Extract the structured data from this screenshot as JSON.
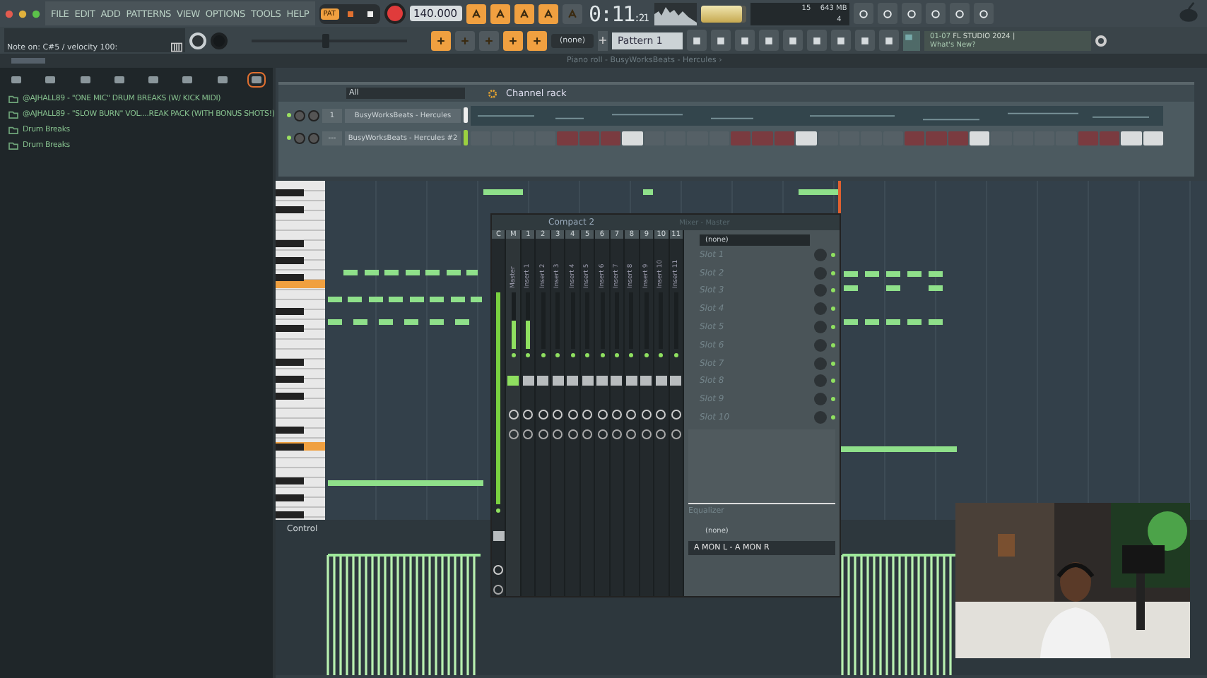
{
  "menu": [
    "FILE",
    "EDIT",
    "ADD",
    "PATTERNS",
    "VIEW",
    "OPTIONS",
    "TOOLS",
    "HELP"
  ],
  "transport": {
    "mode": "PAT",
    "tempo": "140.000",
    "time": "0:11",
    "time_sub": ":21"
  },
  "master_volume": {
    "level": 0.9
  },
  "song_position": {
    "level": 0.45
  },
  "hint": "Note on: C#5 / velocity 100:",
  "monitor": {
    "cpu": "15",
    "ram": "643 MB",
    "voices": "4"
  },
  "pattern": "Pattern 1",
  "plugin_picker": "(none)",
  "news": {
    "date": "01-07",
    "title": "FL STUDIO 2024 |",
    "link": "What's New?"
  },
  "piano_roll_title": "Piano roll - BusyWorksBeats - Hercules ›",
  "browser": {
    "items": [
      {
        "label": "@AJHALL89 - \"ONE MIC\" DRUM BREAKS (W/ KICK MIDI)"
      },
      {
        "label": "@AJHALL89 - \"SLOW BURN\" VOL....REAK PACK (WITH BONUS SHOTS!)"
      },
      {
        "label": "Drum Breaks"
      },
      {
        "label": "Drum Breaks"
      }
    ]
  },
  "channel_rack": {
    "title": "Channel rack",
    "filter": "All",
    "channels": [
      {
        "kind": "roll",
        "number": "1",
        "name": "BusyWorksBeats - Hercules"
      },
      {
        "kind": "steps",
        "number": "---",
        "name": "BusyWorksBeats - Hercules #2",
        "steps": [
          false,
          false,
          false,
          false,
          false,
          false,
          false,
          true,
          false,
          false,
          false,
          false,
          false,
          false,
          false,
          true,
          false,
          false,
          false,
          false,
          false,
          false,
          false,
          true,
          false,
          false,
          false,
          false,
          false,
          false,
          true,
          true
        ]
      }
    ]
  },
  "mixer": {
    "title": "Compact 2",
    "subtitle": "Mixer - Master",
    "tracks": [
      {
        "number": "C"
      },
      {
        "number": "M",
        "name": "Master"
      },
      {
        "number": "1",
        "name": "Insert 1"
      },
      {
        "number": "2",
        "name": "Insert 2"
      },
      {
        "number": "3",
        "name": "Insert 3"
      },
      {
        "number": "4",
        "name": "Insert 4"
      },
      {
        "number": "5",
        "name": "Insert 5"
      },
      {
        "number": "6",
        "name": "Insert 6"
      },
      {
        "number": "7",
        "name": "Insert 7"
      },
      {
        "number": "8",
        "name": "Insert 8"
      },
      {
        "number": "9",
        "name": "Insert 9"
      },
      {
        "number": "10",
        "name": "Insert 10"
      },
      {
        "number": "11",
        "name": "Insert 11"
      }
    ],
    "input": "(none)",
    "slots": [
      "Slot 1",
      "Slot 2",
      "Slot 3",
      "Slot 4",
      "Slot 5",
      "Slot 6",
      "Slot 7",
      "Slot 8",
      "Slot 9",
      "Slot 10"
    ],
    "eq_label": "Equalizer",
    "send": "(none)",
    "output": "A MON L - A MON R"
  },
  "control_label": "Control"
}
